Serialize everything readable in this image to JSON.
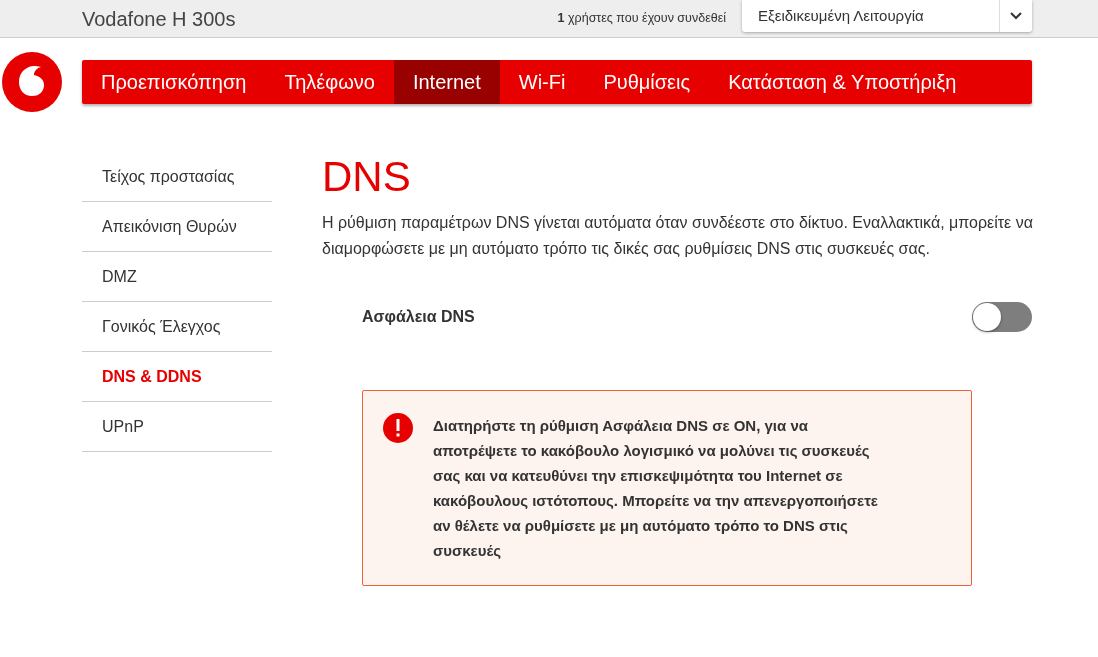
{
  "header": {
    "title": "Vodafone H 300s",
    "users_text": "**1** χρήστες που έχουν συνδεθεί",
    "mode_select": {
      "value": "Εξειδικευμένη Λειτουργία"
    }
  },
  "nav": [
    {
      "label": "Προεπισκόπηση",
      "selected": false
    },
    {
      "label": "Τηλέφωνο",
      "selected": false
    },
    {
      "label": "Internet",
      "selected": true
    },
    {
      "label": "Wi-Fi",
      "selected": false
    },
    {
      "label": "Ρυθμίσεις",
      "selected": false
    },
    {
      "label": "Κατάσταση & Υποστήριξη",
      "selected": false
    }
  ],
  "sidebar": [
    {
      "label": "Τείχος προστασίας",
      "selected": false
    },
    {
      "label": "Απεικόνιση Θυρών",
      "selected": false
    },
    {
      "label": "DMZ",
      "selected": false
    },
    {
      "label": "Γονικός Έλεγχος",
      "selected": false
    },
    {
      "label": "DNS & DDNS",
      "selected": true
    },
    {
      "label": "UPnP",
      "selected": false
    }
  ],
  "page": {
    "title": "DNS",
    "description": "Η ρύθμιση παραμέτρων DNS γίνεται αυτόματα όταν συνδέεστε στο δίκτυο. Εναλλακτικά, μπορείτε να διαμορφώσετε με μη αυτόματο τρόπο τις δικές σας ρυθμίσεις DNS στις συσκευές σας.",
    "setting": {
      "label": "Ασφάλεια DNS",
      "on": false
    },
    "alert": {
      "text": "Διατηρήστε τη ρύθμιση Ασφάλεια DNS σε ON, για να αποτρέψετε το κακόβουλο λογισμικό να μολύνει τις συσκευές σας και να κατευθύνει την επισκεψιμότητα του Internet σε κακόβουλους ιστότοπους. Μπορείτε να την απενεργοποιήσετε αν θέλετε να ρυθμίσετε με μη αυτόματο τρόπο το DNS στις συσκευές"
    }
  }
}
